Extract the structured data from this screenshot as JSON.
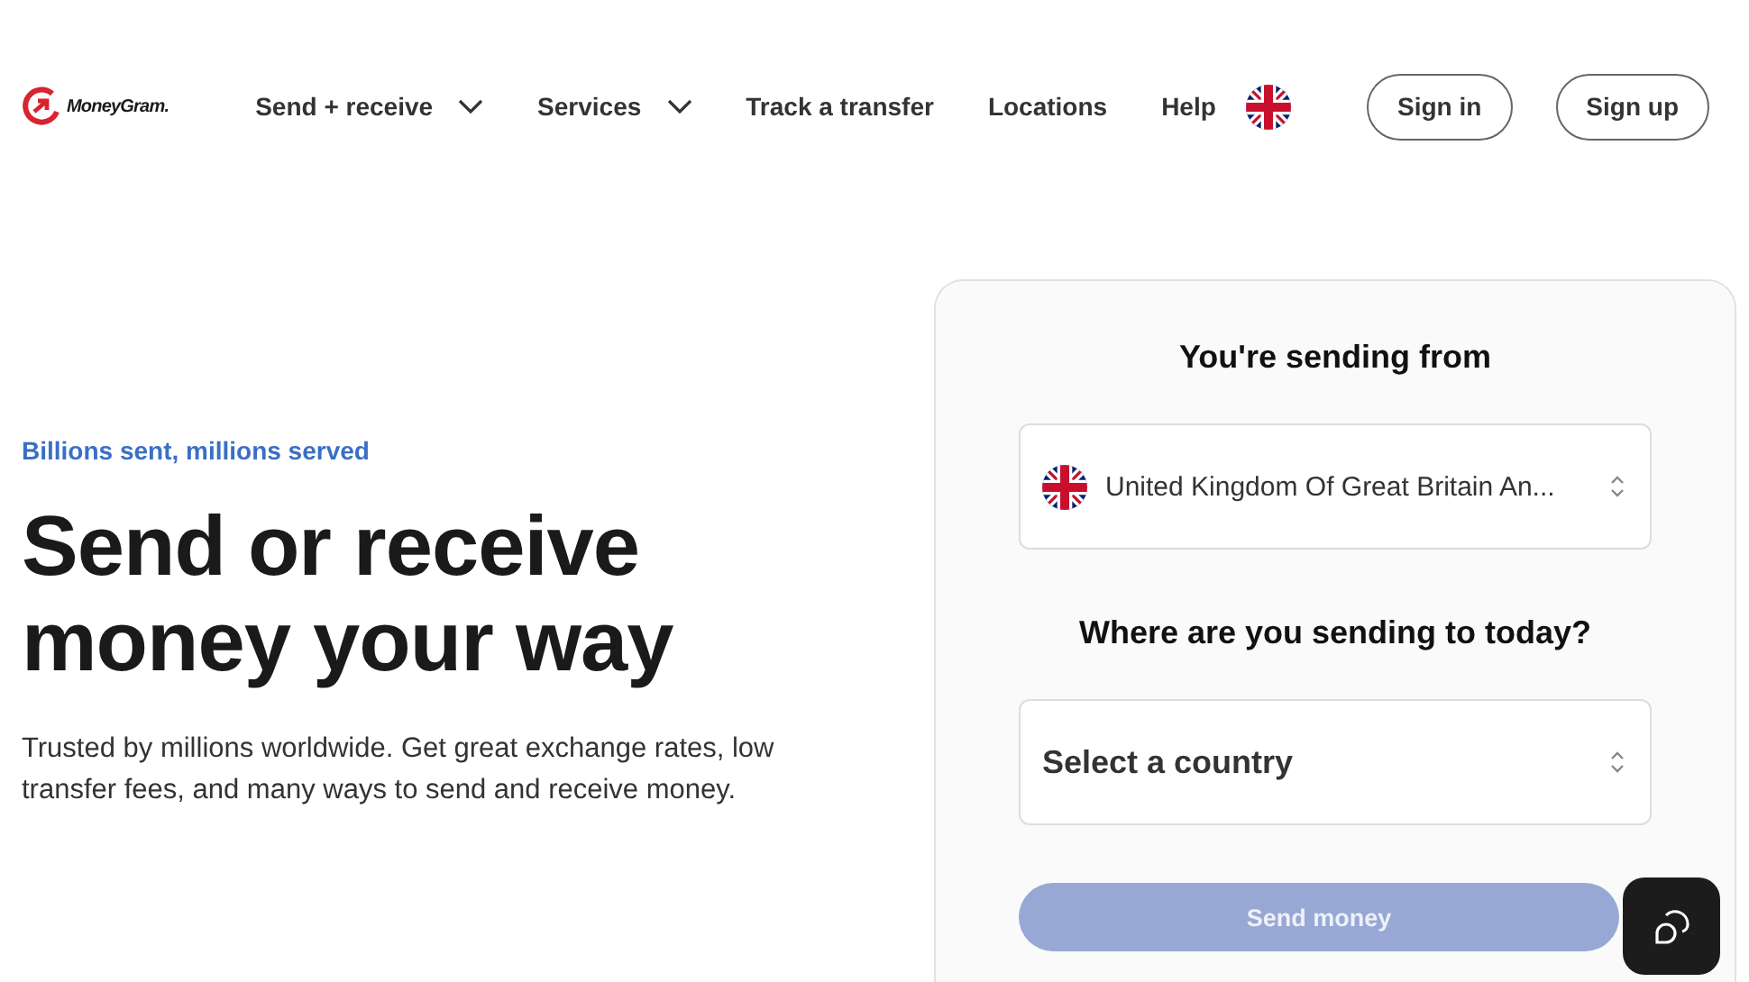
{
  "header": {
    "logo_text": "MoneyGram.",
    "nav": [
      {
        "label": "Send + receive",
        "dropdown": true
      },
      {
        "label": "Services",
        "dropdown": true
      },
      {
        "label": "Track a transfer",
        "dropdown": false
      },
      {
        "label": "Locations",
        "dropdown": false
      },
      {
        "label": "Help",
        "dropdown": false
      }
    ],
    "buttons": [
      "Sign in",
      "Sign up"
    ]
  },
  "hero": {
    "eyebrow": "Billions sent, millions served",
    "title": "Send or receive money your way",
    "description": "Trusted by millions worldwide. Get great exchange rates, low transfer fees, and many ways to send and receive money."
  },
  "card": {
    "from_heading": "You're sending from",
    "from_value": "United Kingdom Of Great Britain An...",
    "to_heading": "Where are you sending to today?",
    "to_placeholder": "Select a country",
    "submit": {
      "label": "Send money",
      "disabled": true
    }
  }
}
